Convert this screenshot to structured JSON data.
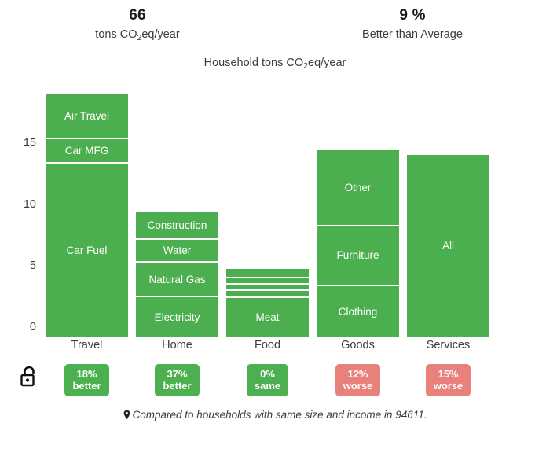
{
  "header": {
    "stats": [
      {
        "value": "66",
        "label_pre": "tons CO",
        "label_sub": "2",
        "label_post": "eq/year"
      },
      {
        "value": "9 %",
        "label_pre": "Better than Average",
        "label_sub": "",
        "label_post": ""
      }
    ]
  },
  "chart_title": {
    "pre": "Household tons CO",
    "sub": "2",
    "post": "eq/year"
  },
  "axis": {
    "ticks": [
      "15",
      "10",
      "5",
      "0"
    ]
  },
  "footnote": {
    "icon": "map-pin-icon",
    "text": "Compared to households with same size and income in 94611."
  },
  "lock": {
    "icon": "unlocked-padlock-icon"
  },
  "chart_data": {
    "type": "bar",
    "subtype": "stacked",
    "title": "Household tons CO2eq/year",
    "xlabel": "",
    "ylabel": "",
    "ylim": [
      0,
      20
    ],
    "yticks": [
      0,
      5,
      10,
      15
    ],
    "grid": false,
    "legend": "none",
    "bar_color": "#4CAF4F",
    "total": 66,
    "total_unit": "tons CO2eq/year",
    "better_than_average_pct": 9,
    "categories": [
      "Travel",
      "Home",
      "Food",
      "Goods",
      "Services"
    ],
    "totals": [
      19.8,
      10.1,
      5.5,
      15.2,
      14.8
    ],
    "stacks": [
      {
        "category": "Travel",
        "total": 19.8,
        "segments": [
          {
            "label": "Air Travel",
            "value": 3.7
          },
          {
            "label": "Car MFG",
            "value": 2.0
          },
          {
            "label": "Car Fuel",
            "value": 14.1
          }
        ]
      },
      {
        "category": "Home",
        "total": 10.1,
        "segments": [
          {
            "label": "Construction",
            "value": 2.2
          },
          {
            "label": "Water",
            "value": 1.9
          },
          {
            "label": "Natural Gas",
            "value": 2.8
          },
          {
            "label": "Electricity",
            "value": 3.2
          }
        ]
      },
      {
        "category": "Food",
        "total": 5.5,
        "segments": [
          {
            "label": "",
            "value": 0.75
          },
          {
            "label": "",
            "value": 0.5
          },
          {
            "label": "",
            "value": 0.5
          },
          {
            "label": "",
            "value": 0.6
          },
          {
            "label": "Meat",
            "value": 3.15
          }
        ]
      },
      {
        "category": "Goods",
        "total": 15.2,
        "segments": [
          {
            "label": "Other",
            "value": 6.2
          },
          {
            "label": "Furniture",
            "value": 4.9
          },
          {
            "label": "Clothing",
            "value": 4.1
          }
        ]
      },
      {
        "category": "Services",
        "total": 14.8,
        "segments": [
          {
            "label": "All",
            "value": 14.8
          }
        ]
      }
    ],
    "comparison_badges": [
      {
        "category": "Travel",
        "pct": "18%",
        "word": "better",
        "status": "good"
      },
      {
        "category": "Home",
        "pct": "37%",
        "word": "better",
        "status": "good"
      },
      {
        "category": "Food",
        "pct": "0%",
        "word": "same",
        "status": "good"
      },
      {
        "category": "Goods",
        "pct": "12%",
        "word": "worse",
        "status": "bad"
      },
      {
        "category": "Services",
        "pct": "15%",
        "word": "worse",
        "status": "bad"
      }
    ]
  }
}
